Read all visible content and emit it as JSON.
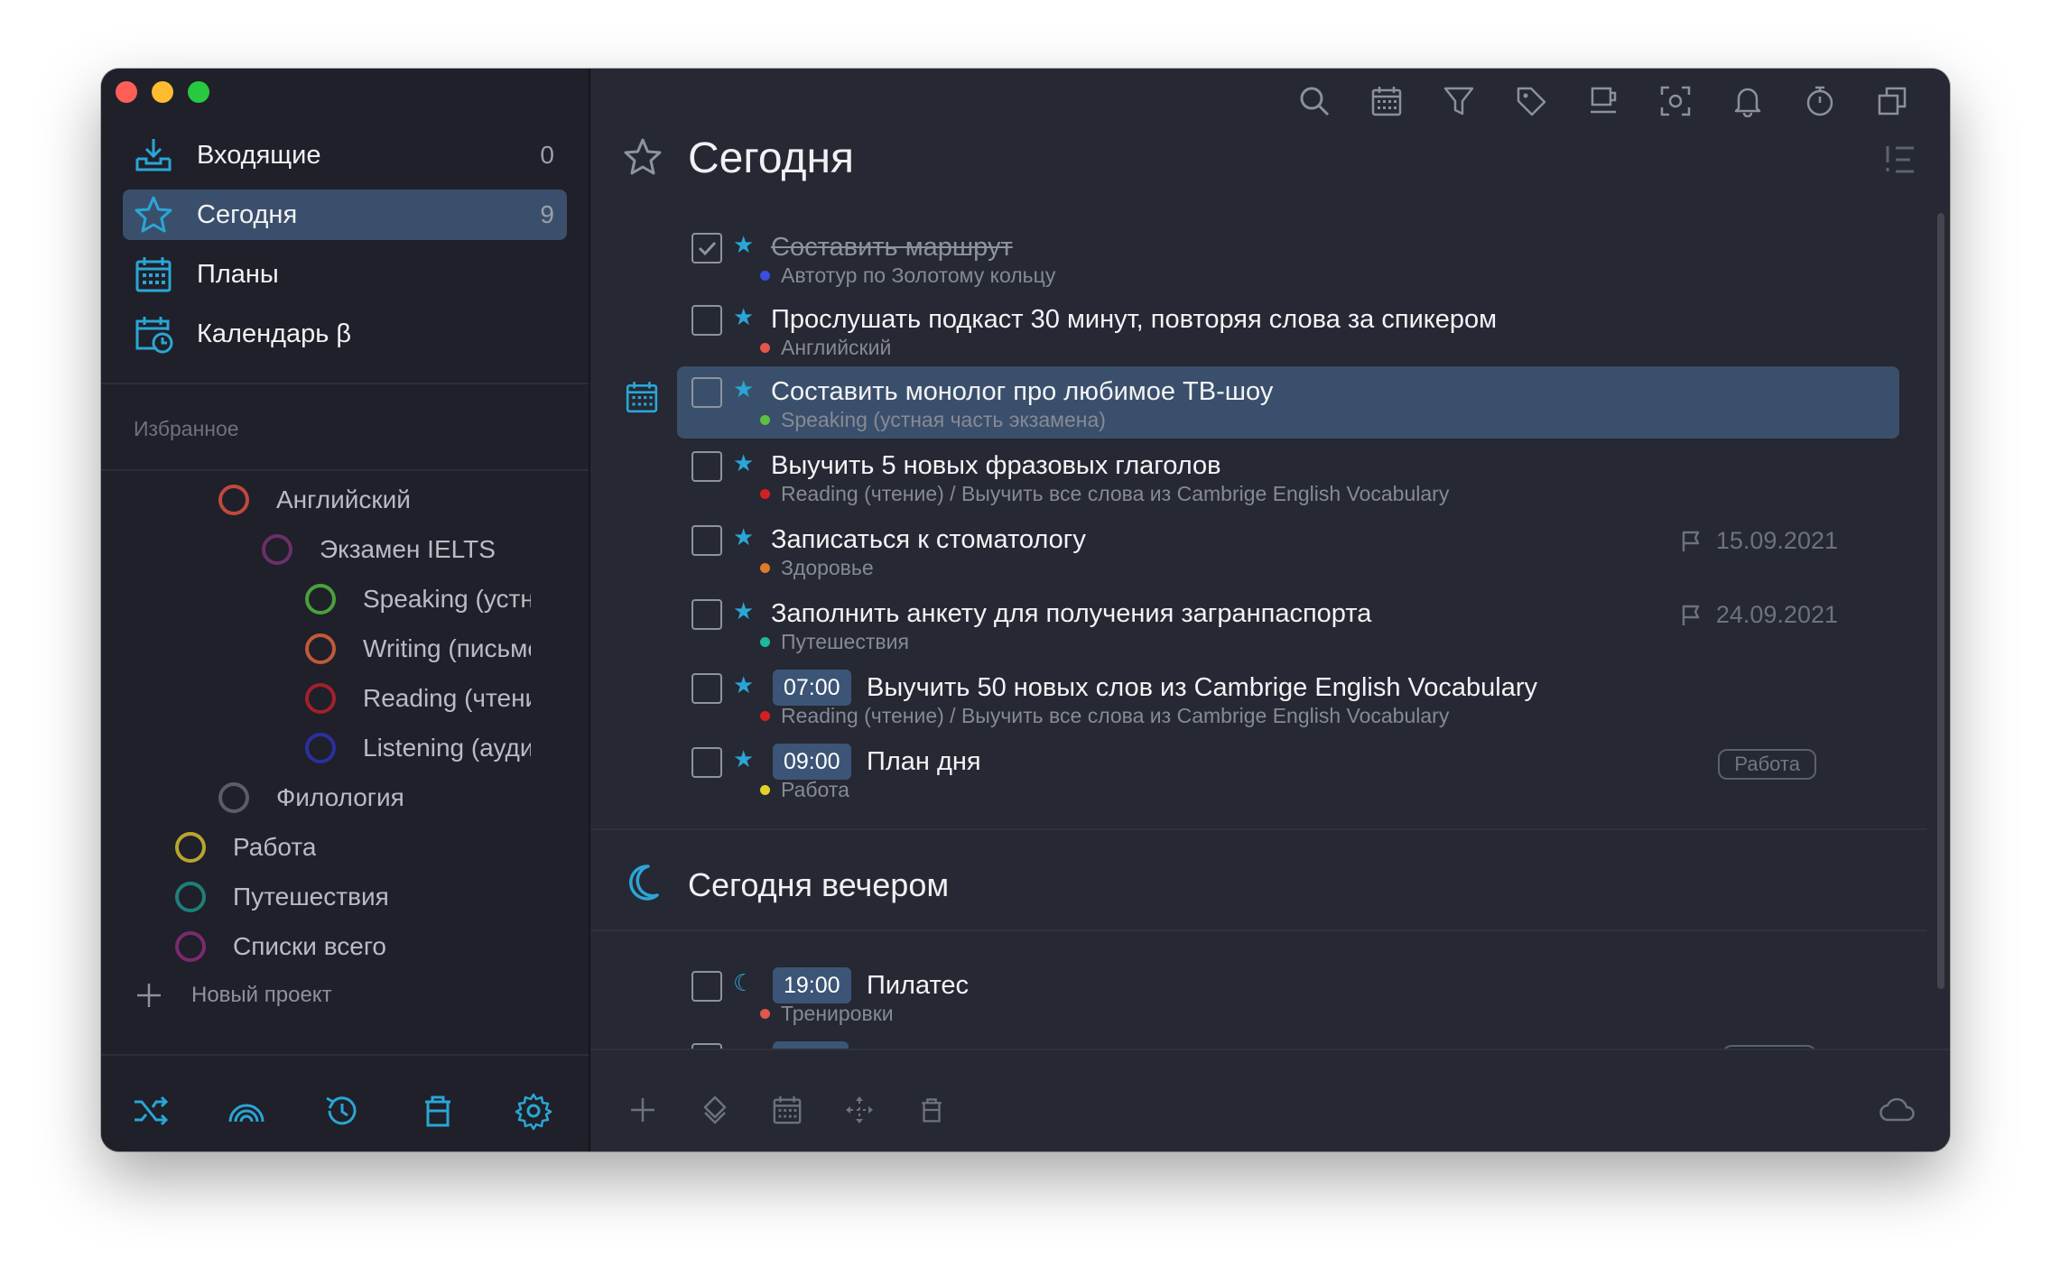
{
  "colors": {
    "accent": "#2aa6d6",
    "sidebar_bg": "#1f2029",
    "main_bg": "#262833",
    "selected": "#3a4f6b"
  },
  "sidebar": {
    "nav": [
      {
        "label": "Входящие",
        "count": "0",
        "icon": "inbox-icon"
      },
      {
        "label": "Сегодня",
        "count": "9",
        "icon": "star-icon"
      },
      {
        "label": "Планы",
        "icon": "calendar-grid-icon"
      },
      {
        "label": "Календарь β",
        "icon": "calendar-clock-icon"
      }
    ],
    "favorites_label": "Избранное",
    "projects": [
      {
        "label": "Английский",
        "color": "#c0483f"
      },
      {
        "label": "Экзамен IELTS",
        "color": "#6b2f6a"
      },
      {
        "label": "Speaking (устная часть экзамена)",
        "color": "#4aa03c"
      },
      {
        "label": "Writing (письменная часть экзамена)",
        "color": "#c05a37"
      },
      {
        "label": "Reading (чтение)",
        "color": "#a3202a"
      },
      {
        "label": "Listening (аудирование)",
        "color": "#2b2fa0"
      },
      {
        "label": "Филология",
        "color": "#5a5d66"
      },
      {
        "label": "Работа",
        "color": "#b8a530"
      },
      {
        "label": "Путешествия",
        "color": "#1e7f7a"
      },
      {
        "label": "Списки всего",
        "color": "#7a2a6e"
      }
    ],
    "new_project_label": "Новый проект",
    "bottom_icons": [
      "shuffle-icon",
      "rainbow-icon",
      "history-icon",
      "trash-icon",
      "settings-icon"
    ]
  },
  "toolbar": {
    "icons": [
      "search-icon",
      "calendar-icon",
      "filter-icon",
      "tag-icon",
      "coffee-icon",
      "focus-icon",
      "bell-icon",
      "timer-icon",
      "windows-icon"
    ]
  },
  "main": {
    "title": "Сегодня",
    "tasks": [
      {
        "title": "Составить маршрут",
        "done": true,
        "project": "Автотур по Золотому кольцу",
        "dot": "#3b4ee0"
      },
      {
        "title": "Прослушать подкаст 30 минут, повторяя слова за спикером",
        "project": "Английский",
        "dot": "#e2564b"
      },
      {
        "title": "Составить монолог про любимое ТВ-шоу",
        "project": "Speaking (устная часть экзамена)",
        "dot": "#5cc040",
        "selected": true
      },
      {
        "title": "Выучить 5 новых фразовых глаголов",
        "project": "Reading (чтение) / Выучить все слова из Cambrige English Vocabulary",
        "dot": "#d62020"
      },
      {
        "title": "Записаться к стоматологу",
        "project": "Здоровье",
        "dot": "#e07a2a",
        "date": "15.09.2021"
      },
      {
        "title": "Заполнить анкету для получения загранпаспорта",
        "project": "Путешествия",
        "dot": "#1eb7a0",
        "date": "24.09.2021"
      },
      {
        "title": "Выучить 50 новых слов из Cambrige English Vocabulary",
        "time": "07:00",
        "project": "Reading (чтение) / Выучить все слова из Cambrige English Vocabulary",
        "dot": "#d62020"
      },
      {
        "title": "План дня",
        "time": "09:00",
        "project": "Работа",
        "dot": "#e6d12a",
        "tag": "Работа"
      }
    ],
    "evening_title": "Сегодня вечером",
    "evening_tasks": [
      {
        "title": "Пилатес",
        "time": "19:00",
        "project": "Тренировки",
        "dot": "#e2564b"
      }
    ]
  },
  "bottom_bar": {
    "icons": [
      "add-icon",
      "diamond-icon",
      "calendar-icon",
      "move-icon",
      "trash-icon",
      "cloud-icon"
    ]
  }
}
